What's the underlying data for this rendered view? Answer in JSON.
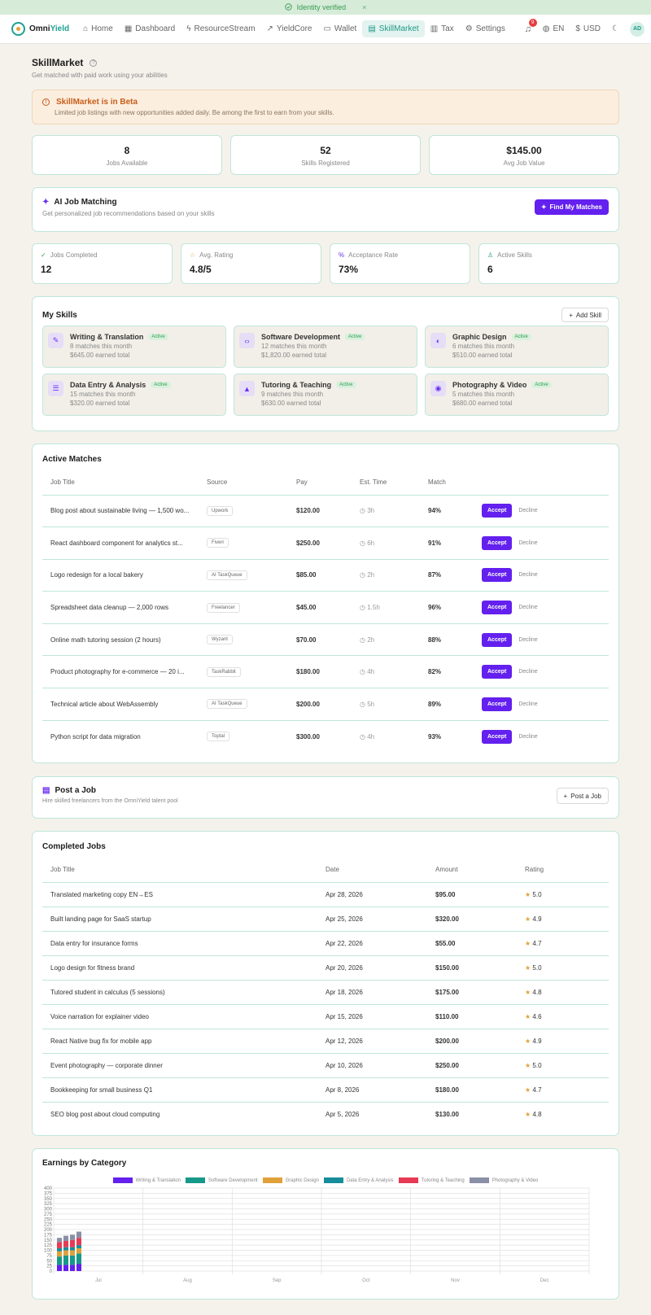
{
  "banner": {
    "text": "Identity verified",
    "close": "×"
  },
  "nav": {
    "brand": {
      "part1": "Omni",
      "part2": "Yield"
    },
    "items": [
      {
        "label": "Home",
        "icon": "⌂"
      },
      {
        "label": "Dashboard",
        "icon": "▦"
      },
      {
        "label": "ResourceStream",
        "icon": "ϟ"
      },
      {
        "label": "YieldCore",
        "icon": "↗"
      },
      {
        "label": "Wallet",
        "icon": "▭"
      },
      {
        "label": "SkillMarket",
        "icon": "▤"
      },
      {
        "label": "Tax",
        "icon": "▥"
      },
      {
        "label": "Settings",
        "icon": "⚙"
      }
    ],
    "notif_count": "9",
    "lang": "EN",
    "currency": "USD",
    "avatar": "AD"
  },
  "page": {
    "title": "SkillMarket",
    "subtitle": "Get matched with paid work using your abilities"
  },
  "beta": {
    "title": "SkillMarket is in Beta",
    "desc": "Limited job listings with new opportunities added daily. Be among the first to earn from your skills."
  },
  "top_stats": [
    {
      "value": "8",
      "label": "Jobs Available"
    },
    {
      "value": "52",
      "label": "Skills Registered"
    },
    {
      "value": "$145.00",
      "label": "Avg Job Value"
    }
  ],
  "ai": {
    "title": "AI Job Matching",
    "desc": "Get personalized job recommendations based on your skills",
    "button": "Find My Matches"
  },
  "kpis": [
    {
      "label": "Jobs Completed",
      "value": "12",
      "icon": "✓",
      "color": "#2ea24f"
    },
    {
      "label": "Avg. Rating",
      "value": "4.8/5",
      "icon": "☆",
      "color": "#e0a33a"
    },
    {
      "label": "Acceptance Rate",
      "value": "73%",
      "icon": "%",
      "color": "#6a2ff0"
    },
    {
      "label": "Active Skills",
      "value": "6",
      "icon": "♙",
      "color": "#1f9a8a"
    }
  ],
  "skills": {
    "title": "My Skills",
    "add": "Add Skill",
    "active_label": "Active",
    "items": [
      {
        "name": "Writing & Translation",
        "matches": "8 matches this month",
        "earned": "$645.00 earned total",
        "icon": "✎"
      },
      {
        "name": "Software Development",
        "matches": "12 matches this month",
        "earned": "$1,820.00 earned total",
        "icon": "‹›"
      },
      {
        "name": "Graphic Design",
        "matches": "6 matches this month",
        "earned": "$510.00 earned total",
        "icon": "◐"
      },
      {
        "name": "Data Entry & Analysis",
        "matches": "15 matches this month",
        "earned": "$320.00 earned total",
        "icon": "☰"
      },
      {
        "name": "Tutoring & Teaching",
        "matches": "9 matches this month",
        "earned": "$630.00 earned total",
        "icon": "▲"
      },
      {
        "name": "Photography & Video",
        "matches": "5 matches this month",
        "earned": "$680.00 earned total",
        "icon": "◉"
      }
    ]
  },
  "matches": {
    "title": "Active Matches",
    "headers": [
      "Job Title",
      "Source",
      "Pay",
      "Est. Time",
      "Match"
    ],
    "accept": "Accept",
    "decline": "Decline",
    "rows": [
      {
        "title": "Blog post about sustainable living — 1,500 wo...",
        "source": "Upwork",
        "pay": "$120.00",
        "time": "3h",
        "match": "94%",
        "level": "good"
      },
      {
        "title": "React dashboard component for analytics st...",
        "source": "Fiverr",
        "pay": "$250.00",
        "time": "6h",
        "match": "91%",
        "level": "good"
      },
      {
        "title": "Logo redesign for a local bakery",
        "source": "AI TaskQueue",
        "pay": "$85.00",
        "time": "2h",
        "match": "87%",
        "level": "warn"
      },
      {
        "title": "Spreadsheet data cleanup — 2,000 rows",
        "source": "Freelancer",
        "pay": "$45.00",
        "time": "1.5h",
        "match": "96%",
        "level": "good"
      },
      {
        "title": "Online math tutoring session (2 hours)",
        "source": "Wyzant",
        "pay": "$70.00",
        "time": "2h",
        "match": "88%",
        "level": "warn"
      },
      {
        "title": "Product photography for e-commerce — 20 i...",
        "source": "TaskRabbit",
        "pay": "$180.00",
        "time": "4h",
        "match": "82%",
        "level": "warn"
      },
      {
        "title": "Technical article about WebAssembly",
        "source": "AI TaskQueue",
        "pay": "$200.00",
        "time": "5h",
        "match": "89%",
        "level": "warn"
      },
      {
        "title": "Python script for data migration",
        "source": "Toptal",
        "pay": "$300.00",
        "time": "4h",
        "match": "93%",
        "level": "good"
      }
    ]
  },
  "post": {
    "title": "Post a Job",
    "desc": "Hire skilled freelancers from the OmniYield talent pool",
    "button": "Post a Job"
  },
  "completed": {
    "title": "Completed Jobs",
    "headers": [
      "Job Title",
      "Date",
      "Amount",
      "Rating"
    ],
    "rows": [
      {
        "title": "Translated marketing copy EN→ES",
        "date": "Apr 28, 2026",
        "amount": "$95.00",
        "rating": "5.0"
      },
      {
        "title": "Built landing page for SaaS startup",
        "date": "Apr 25, 2026",
        "amount": "$320.00",
        "rating": "4.9"
      },
      {
        "title": "Data entry for insurance forms",
        "date": "Apr 22, 2026",
        "amount": "$55.00",
        "rating": "4.7"
      },
      {
        "title": "Logo design for fitness brand",
        "date": "Apr 20, 2026",
        "amount": "$150.00",
        "rating": "5.0"
      },
      {
        "title": "Tutored student in calculus (5 sessions)",
        "date": "Apr 18, 2026",
        "amount": "$175.00",
        "rating": "4.8"
      },
      {
        "title": "Voice narration for explainer video",
        "date": "Apr 15, 2026",
        "amount": "$110.00",
        "rating": "4.6"
      },
      {
        "title": "React Native bug fix for mobile app",
        "date": "Apr 12, 2026",
        "amount": "$200.00",
        "rating": "4.9"
      },
      {
        "title": "Event photography — corporate dinner",
        "date": "Apr 10, 2026",
        "amount": "$250.00",
        "rating": "5.0"
      },
      {
        "title": "Bookkeeping for small business Q1",
        "date": "Apr 8, 2026",
        "amount": "$180.00",
        "rating": "4.7"
      },
      {
        "title": "SEO blog post about cloud computing",
        "date": "Apr 5, 2026",
        "amount": "$130.00",
        "rating": "4.8"
      }
    ]
  },
  "earnings_title": "Earnings by Category",
  "chart_data": {
    "type": "bar",
    "stacked": true,
    "x_ticks": [
      "Jul",
      "Aug",
      "Sep",
      "Oct",
      "Nov",
      "Dec"
    ],
    "ylim": [
      0,
      400
    ],
    "y_ticks": [
      0,
      25,
      50,
      75,
      100,
      125,
      150,
      175,
      200,
      225,
      250,
      275,
      300,
      325,
      350,
      375,
      400
    ],
    "grid": true,
    "legend_position": "top",
    "series": [
      {
        "name": "Writing & Translation",
        "color": "#6320ee",
        "values": [
          30,
          30,
          30,
          35
        ]
      },
      {
        "name": "Software Development",
        "color": "#17998a",
        "values": [
          40,
          45,
          45,
          50
        ]
      },
      {
        "name": "Graphic Design",
        "color": "#e0a13a",
        "values": [
          25,
          25,
          25,
          25
        ]
      },
      {
        "name": "Data Entry & Analysis",
        "color": "#178c9a",
        "values": [
          15,
          15,
          15,
          15
        ]
      },
      {
        "name": "Tutoring & Teaching",
        "color": "#e63a55",
        "values": [
          30,
          30,
          35,
          35
        ]
      },
      {
        "name": "Photography & Video",
        "color": "#8a8fa6",
        "values": [
          20,
          25,
          25,
          30
        ]
      }
    ]
  }
}
